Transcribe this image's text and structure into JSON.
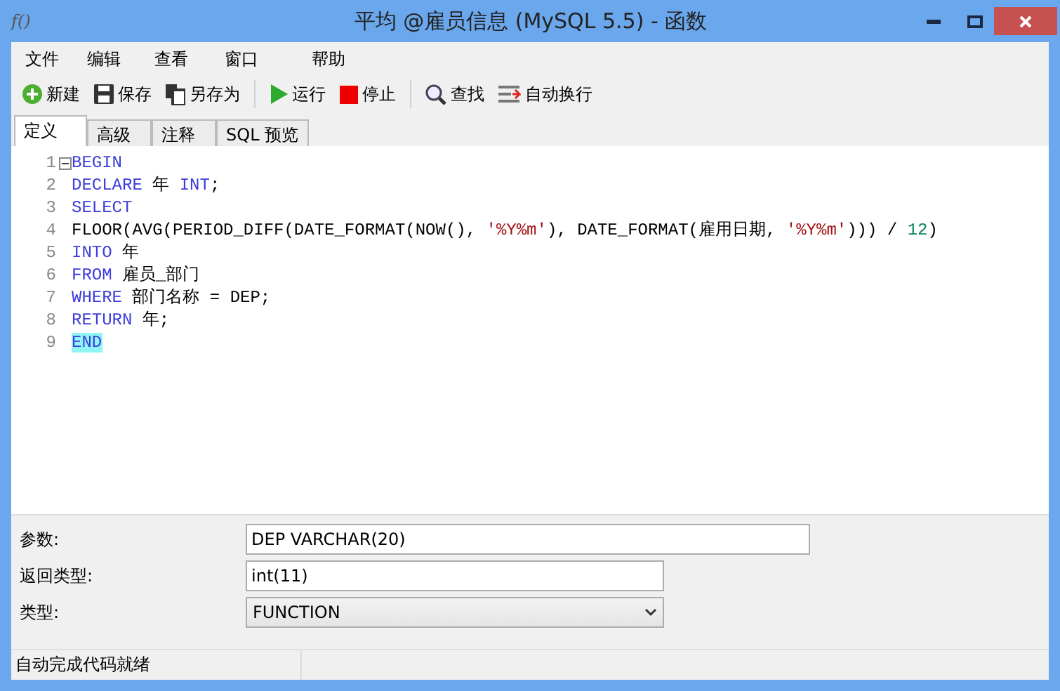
{
  "window": {
    "icon_text": "f()",
    "title": "平均 @雇员信息 (MySQL 5.5) - 函数"
  },
  "menu": [
    "文件",
    "编辑",
    "查看",
    "窗口",
    "帮助"
  ],
  "toolbar": [
    {
      "kind": "new",
      "label": "新建"
    },
    {
      "kind": "save",
      "label": "保存"
    },
    {
      "kind": "saveas",
      "label": "另存为"
    },
    {
      "kind": "sep"
    },
    {
      "kind": "run",
      "label": "运行"
    },
    {
      "kind": "stop",
      "label": "停止"
    },
    {
      "kind": "sep"
    },
    {
      "kind": "find",
      "label": "查找"
    },
    {
      "kind": "wrap",
      "label": "自动换行"
    }
  ],
  "tabs": [
    {
      "label": "定义",
      "selected": true
    },
    {
      "label": "高级",
      "selected": false
    },
    {
      "label": "注释",
      "selected": false
    },
    {
      "label": "SQL 预览",
      "selected": false
    }
  ],
  "code": [
    {
      "n": "1",
      "tokens": [
        {
          "kind": "kw",
          "text": "BEGIN"
        }
      ]
    },
    {
      "n": "2",
      "tokens": [
        {
          "kind": "kw",
          "text": "DECLARE"
        },
        {
          "kind": "plain",
          "text": " 年 "
        },
        {
          "kind": "kw",
          "text": "INT"
        },
        {
          "kind": "plain",
          "text": ";"
        }
      ]
    },
    {
      "n": "3",
      "tokens": [
        {
          "kind": "kw",
          "text": "SELECT"
        }
      ]
    },
    {
      "n": "4",
      "tokens": [
        {
          "kind": "plain",
          "text": "FLOOR(AVG(PERIOD_DIFF(DATE_FORMAT(NOW(), "
        },
        {
          "kind": "str",
          "text": "'%Y%m'"
        },
        {
          "kind": "plain",
          "text": "), DATE_FORMAT(雇用日期, "
        },
        {
          "kind": "str",
          "text": "'%Y%m'"
        },
        {
          "kind": "plain",
          "text": "))) / "
        },
        {
          "kind": "num",
          "text": "12"
        },
        {
          "kind": "plain",
          "text": ")"
        }
      ]
    },
    {
      "n": "5",
      "tokens": [
        {
          "kind": "kw",
          "text": "INTO"
        },
        {
          "kind": "plain",
          "text": " 年"
        }
      ]
    },
    {
      "n": "6",
      "tokens": [
        {
          "kind": "kw",
          "text": "FROM"
        },
        {
          "kind": "plain",
          "text": " 雇员_部门"
        }
      ]
    },
    {
      "n": "7",
      "tokens": [
        {
          "kind": "kw",
          "text": "WHERE"
        },
        {
          "kind": "plain",
          "text": " 部门名称 = DEP;"
        }
      ]
    },
    {
      "n": "8",
      "tokens": [
        {
          "kind": "kw",
          "text": "RETURN"
        },
        {
          "kind": "plain",
          "text": " 年;"
        }
      ]
    },
    {
      "n": "9",
      "tokens": [
        {
          "kind": "match",
          "text": "END"
        }
      ]
    }
  ],
  "form": [
    {
      "kind": "text",
      "label": "参数:",
      "value": "DEP VARCHAR(20)",
      "wide": true
    },
    {
      "kind": "text",
      "label": "返回类型:",
      "value": "int(11)",
      "wide": false
    },
    {
      "kind": "select",
      "label": "类型:",
      "value": "FUNCTION",
      "wide": false
    }
  ],
  "status_bar": "自动完成代码就绪"
}
